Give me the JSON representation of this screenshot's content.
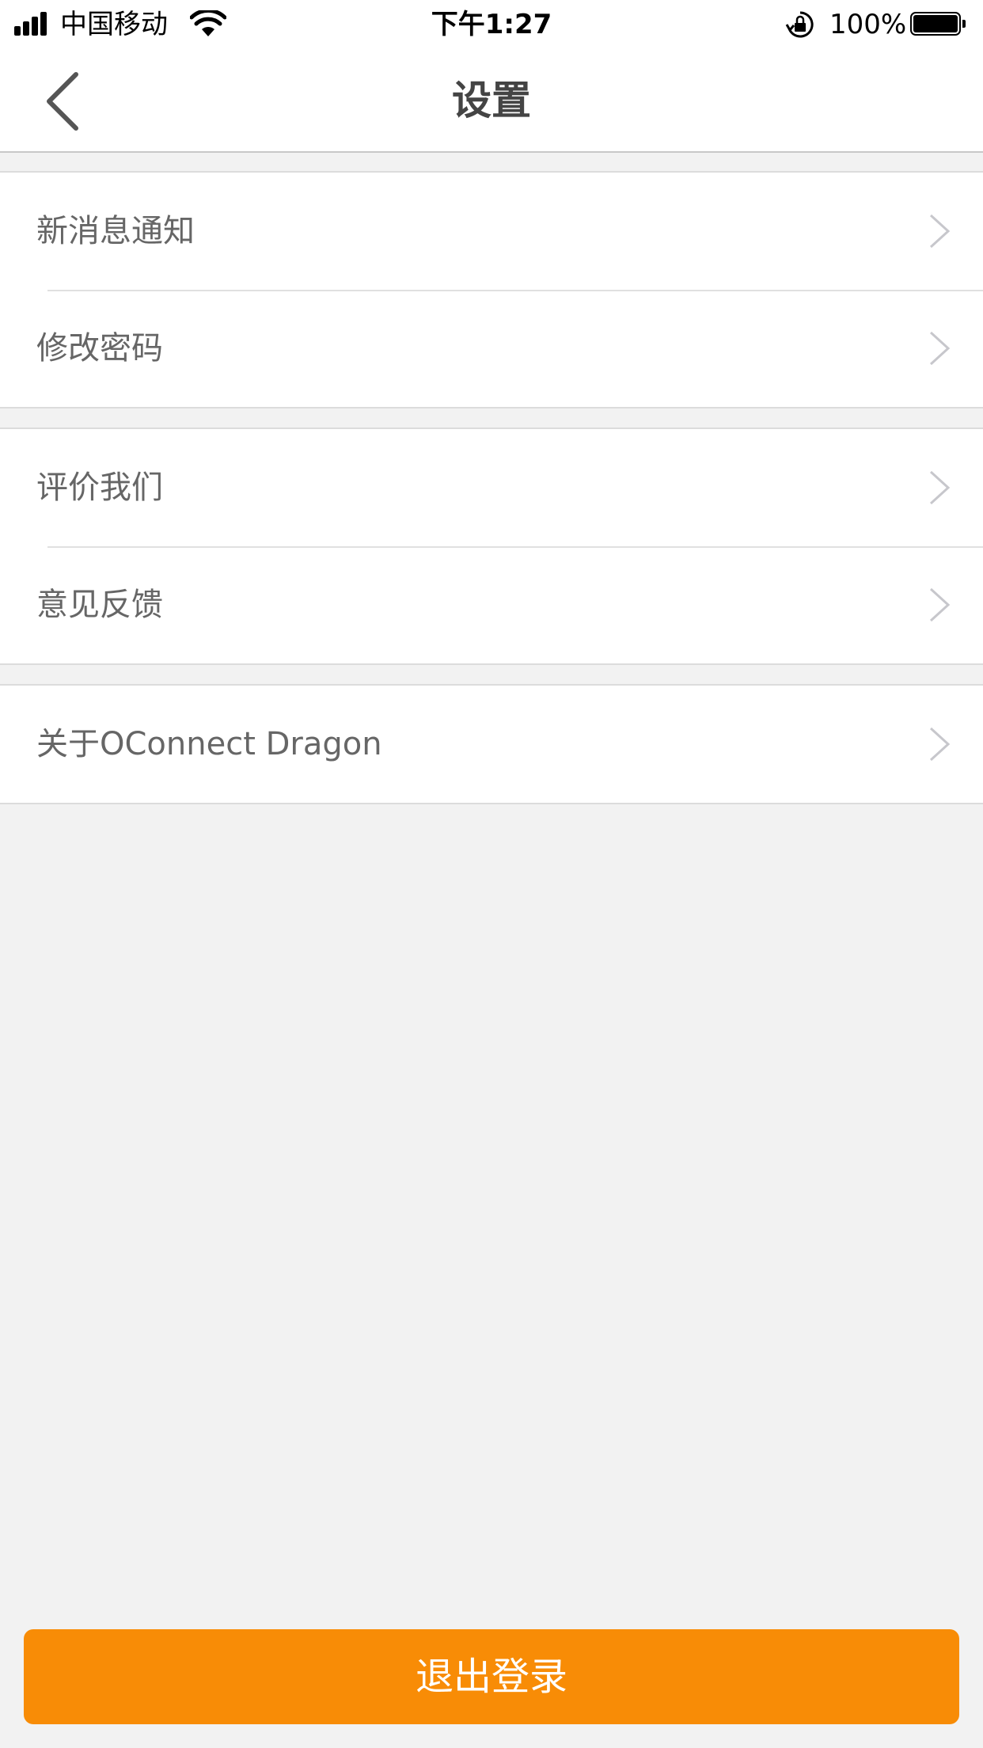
{
  "status_bar": {
    "carrier": "中国移动",
    "time": "下午1:27",
    "battery": "100%"
  },
  "nav": {
    "title": "设置"
  },
  "groups": [
    {
      "items": [
        {
          "label": "新消息通知"
        },
        {
          "label": "修改密码"
        }
      ]
    },
    {
      "items": [
        {
          "label": "评价我们"
        },
        {
          "label": "意见反馈"
        }
      ]
    },
    {
      "items": [
        {
          "label": "关于OConnect Dragon"
        }
      ]
    }
  ],
  "logout": {
    "label": "退出登录"
  },
  "colors": {
    "accent": "#f88c06",
    "background": "#f2f2f2",
    "label": "#666666"
  }
}
